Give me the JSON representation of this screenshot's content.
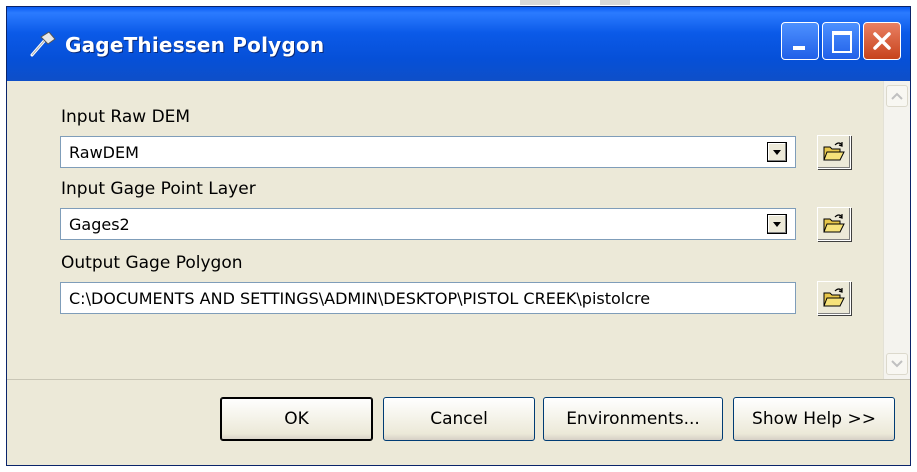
{
  "window": {
    "title": "GageThiessen Polygon"
  },
  "fields": [
    {
      "label": "Input Raw DEM",
      "value": "RawDEM"
    },
    {
      "label": "Input Gage Point Layer",
      "value": "Gages2"
    },
    {
      "label": "Output Gage Polygon",
      "value": "C:\\DOCUMENTS AND SETTINGS\\ADMIN\\DESKTOP\\PISTOL CREEK\\pistolcre"
    }
  ],
  "buttons": {
    "ok": "OK",
    "cancel": "Cancel",
    "environments": "Environments...",
    "show_help": "Show Help >>"
  },
  "icons": {
    "title": "hammer-icon",
    "browse": "open-folder-icon",
    "minimize": "minimize-icon",
    "maximize": "maximize-icon",
    "close": "close-icon",
    "dropdown": "chevron-down-icon"
  },
  "colors": {
    "titlebar": "#0b5ae8",
    "dialog_bg": "#ece9d8",
    "close_button": "#c7431c"
  }
}
